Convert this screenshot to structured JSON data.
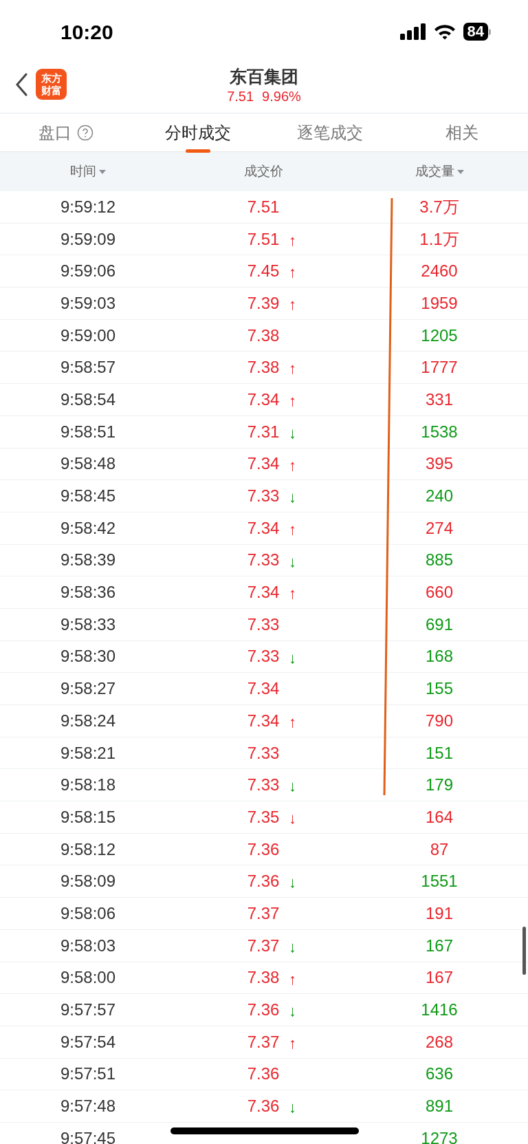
{
  "status_bar": {
    "time": "10:20",
    "battery": "84"
  },
  "header": {
    "logo": [
      "东方",
      "财富"
    ],
    "title": "东百集团",
    "price": "7.51",
    "change": "9.96%"
  },
  "tabs": [
    {
      "label": "盘口",
      "help": true,
      "selected": false
    },
    {
      "label": "分时成交",
      "help": false,
      "selected": true
    },
    {
      "label": "逐笔成交",
      "help": false,
      "selected": false
    },
    {
      "label": "相关",
      "help": false,
      "selected": false
    }
  ],
  "table": {
    "columns": [
      {
        "label": "时间",
        "sortable": true
      },
      {
        "label": "成交价",
        "sortable": false
      },
      {
        "label": "成交量",
        "sortable": true
      }
    ],
    "rows": [
      {
        "time": "9:59:12",
        "price": "7.51",
        "volume": "3.7万",
        "color": "#e8262d"
      },
      {
        "time": "9:59:09",
        "price": "7.51",
        "arrow": "↑",
        "volume": "1.1万",
        "color": "#e8262d"
      },
      {
        "time": "9:59:06",
        "price": "7.45",
        "arrow": "↑",
        "volume": "2460",
        "color": "#e8262d"
      },
      {
        "time": "9:59:03",
        "price": "7.39",
        "arrow": "↑",
        "volume": "1959",
        "color": "#e8262d"
      },
      {
        "time": "9:59:00",
        "price": "7.38",
        "volume": "1205",
        "color": "#0d9a16"
      },
      {
        "time": "9:58:57",
        "price": "7.38",
        "arrow": "↑",
        "volume": "1777",
        "color": "#e8262d"
      },
      {
        "time": "9:58:54",
        "price": "7.34",
        "arrow": "↑",
        "volume": "331",
        "color": "#e8262d"
      },
      {
        "time": "9:58:51",
        "price": "7.31",
        "arrow": "↓",
        "volume": "1538",
        "color": "#0d9a16"
      },
      {
        "time": "9:58:48",
        "price": "7.34",
        "arrow": "↑",
        "volume": "395",
        "color": "#e8262d"
      },
      {
        "time": "9:58:45",
        "price": "7.33",
        "arrow": "↓",
        "volume": "240",
        "color": "#0d9a16"
      },
      {
        "time": "9:58:42",
        "price": "7.34",
        "arrow": "↑",
        "volume": "274",
        "color": "#e8262d"
      },
      {
        "time": "9:58:39",
        "price": "7.33",
        "arrow": "↓",
        "volume": "885",
        "color": "#0d9a16"
      },
      {
        "time": "9:58:36",
        "price": "7.34",
        "arrow": "↑",
        "volume": "660",
        "color": "#e8262d"
      },
      {
        "time": "9:58:33",
        "price": "7.33",
        "volume": "691",
        "color": "#0d9a16"
      },
      {
        "time": "9:58:30",
        "price": "7.33",
        "arrow": "↓",
        "volume": "168",
        "color": "#0d9a16"
      },
      {
        "time": "9:58:27",
        "price": "7.34",
        "volume": "155",
        "color": "#0d9a16"
      },
      {
        "time": "9:58:24",
        "price": "7.34",
        "arrow": "↑",
        "volume": "790",
        "color": "#e8262d"
      },
      {
        "time": "9:58:21",
        "price": "7.33",
        "volume": "151",
        "color": "#0d9a16"
      },
      {
        "time": "9:58:18",
        "price": "7.33",
        "arrow": "↓",
        "volume": "179",
        "color": "#0d9a16"
      },
      {
        "time": "9:58:15",
        "price": "7.35",
        "arrow": "↓",
        "volume": "164",
        "color": "#e8262d"
      },
      {
        "time": "9:58:12",
        "price": "7.36",
        "volume": "87",
        "color": "#e8262d"
      },
      {
        "time": "9:58:09",
        "price": "7.36",
        "arrow": "↓",
        "volume": "1551",
        "color": "#0d9a16"
      },
      {
        "time": "9:58:06",
        "price": "7.37",
        "volume": "191",
        "color": "#e8262d"
      },
      {
        "time": "9:58:03",
        "price": "7.37",
        "arrow": "↓",
        "volume": "167",
        "color": "#0d9a16"
      },
      {
        "time": "9:58:00",
        "price": "7.38",
        "arrow": "↑",
        "volume": "167",
        "color": "#e8262d"
      },
      {
        "time": "9:57:57",
        "price": "7.36",
        "arrow": "↓",
        "volume": "1416",
        "color": "#0d9a16"
      },
      {
        "time": "9:57:54",
        "price": "7.37",
        "arrow": "↑",
        "volume": "268",
        "color": "#e8262d"
      },
      {
        "time": "9:57:51",
        "price": "7.36",
        "volume": "636",
        "color": "#0d9a16"
      },
      {
        "time": "9:57:48",
        "price": "7.36",
        "arrow": "↓",
        "volume": "891",
        "color": "#0d9a16"
      },
      {
        "time": "9:57:45",
        "volume": "1273",
        "color": "#0d9a16"
      }
    ]
  }
}
